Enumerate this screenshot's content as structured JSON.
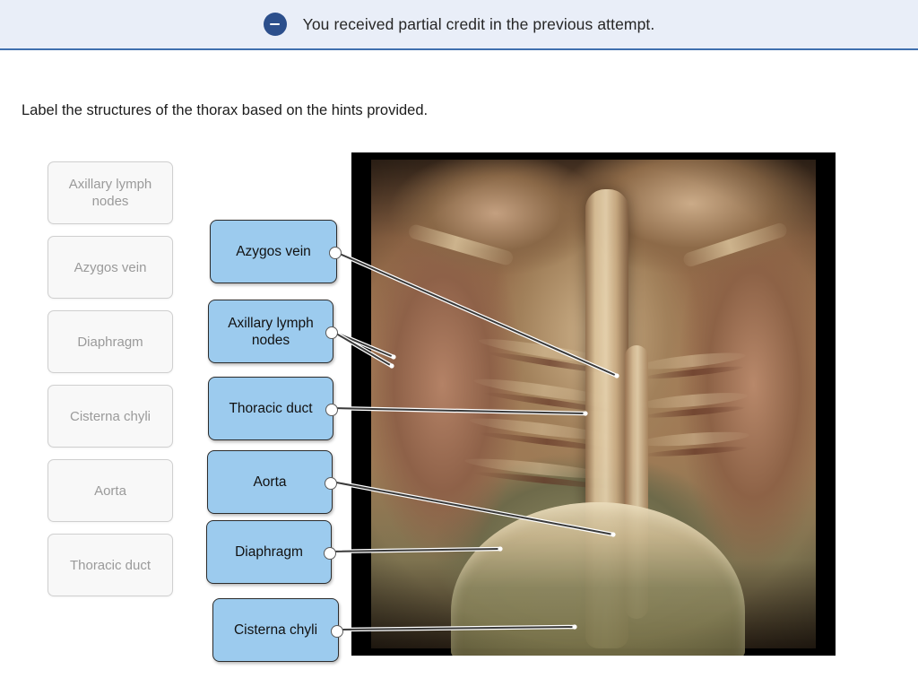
{
  "banner": {
    "icon": "minus-circle-icon",
    "message": "You received partial credit in the previous attempt.",
    "background_color": "#e9eef8",
    "border_color": "#3f6fae",
    "icon_color": "#2c4f8c"
  },
  "prompt": {
    "text": "Label the structures of the thorax based on the hints provided."
  },
  "word_bank": {
    "items": [
      {
        "label": "Axillary lymph nodes"
      },
      {
        "label": "Azygos vein"
      },
      {
        "label": "Diaphragm"
      },
      {
        "label": "Cisterna chyli"
      },
      {
        "label": "Aorta"
      },
      {
        "label": "Thoracic duct"
      }
    ],
    "chip_background": "#f8f8f8",
    "chip_text_color": "#9a9a9a"
  },
  "answer_tiles": {
    "tile_background": "#9ccbee",
    "tile_text_color": "#111111",
    "items": [
      {
        "label": "Azygos vein"
      },
      {
        "label": "Axillary lymph nodes"
      },
      {
        "label": "Thoracic duct"
      },
      {
        "label": "Aorta"
      },
      {
        "label": "Diaphragm"
      },
      {
        "label": "Cisterna chyli"
      }
    ]
  },
  "figure": {
    "name": "thorax-cadaver-dissection-photo",
    "alt": "Anterior dissection of the human thorax showing ribs, mediastinum, great vessels and diaphragm"
  }
}
